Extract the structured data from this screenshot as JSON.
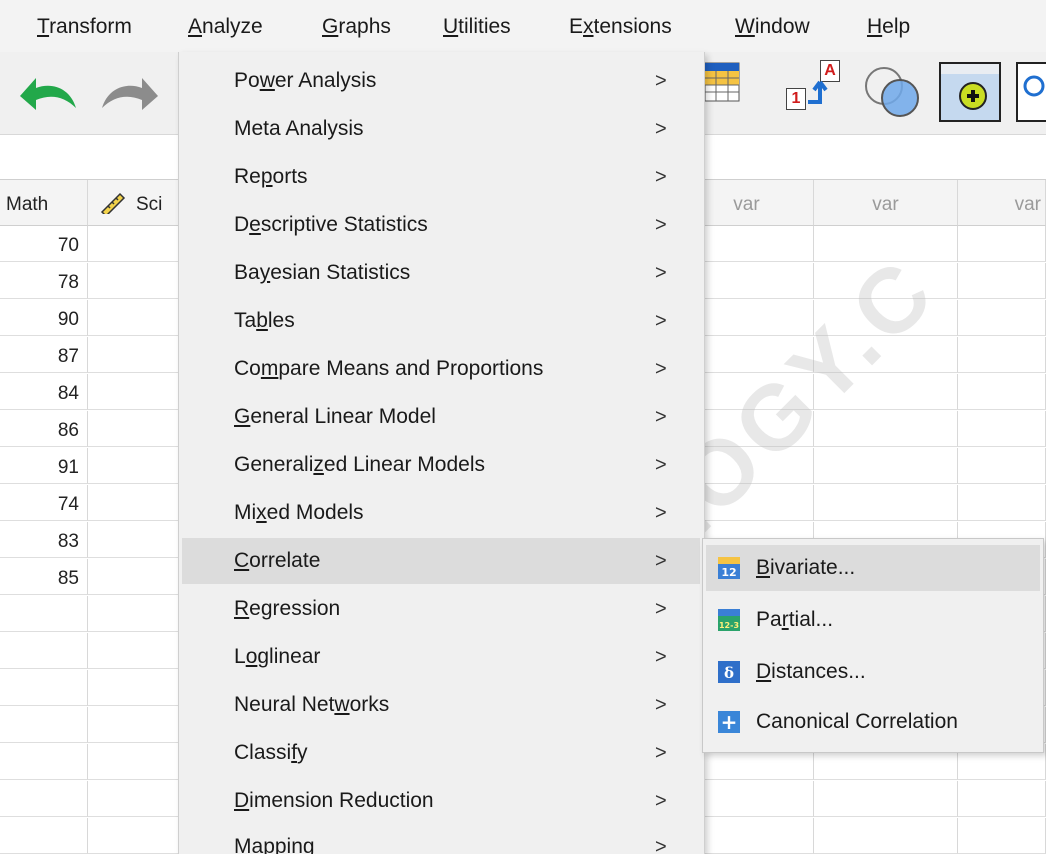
{
  "menubar": [
    {
      "pre": "",
      "u": "T",
      "post": "ransform"
    },
    {
      "pre": "",
      "u": "A",
      "post": "nalyze"
    },
    {
      "pre": "",
      "u": "G",
      "post": "raphs"
    },
    {
      "pre": "",
      "u": "U",
      "post": "tilities"
    },
    {
      "pre": "E",
      "u": "x",
      "post": "tensions"
    },
    {
      "pre": "",
      "u": "W",
      "post": "indow"
    },
    {
      "pre": "",
      "u": "H",
      "post": "elp"
    }
  ],
  "grid": {
    "headers": [
      "Math",
      "Sci",
      "var",
      "var",
      "var"
    ],
    "math_values": [
      "70",
      "78",
      "90",
      "87",
      "84",
      "86",
      "91",
      "74",
      "83",
      "85"
    ]
  },
  "analyze_menu": [
    {
      "pre": "Po",
      "u": "w",
      "post": "er Analysis"
    },
    {
      "pre": "Meta Analysis",
      "u": "",
      "post": ""
    },
    {
      "pre": "Re",
      "u": "p",
      "post": "orts"
    },
    {
      "pre": "D",
      "u": "e",
      "post": "scriptive Statistics"
    },
    {
      "pre": "Ba",
      "u": "y",
      "post": "esian Statistics"
    },
    {
      "pre": "Ta",
      "u": "b",
      "post": "les"
    },
    {
      "pre": "Co",
      "u": "m",
      "post": "pare Means and Proportions"
    },
    {
      "pre": "",
      "u": "G",
      "post": "eneral Linear Model"
    },
    {
      "pre": "Generali",
      "u": "z",
      "post": "ed Linear Models"
    },
    {
      "pre": "Mi",
      "u": "x",
      "post": "ed Models"
    },
    {
      "pre": "",
      "u": "C",
      "post": "orrelate"
    },
    {
      "pre": "",
      "u": "R",
      "post": "egression"
    },
    {
      "pre": "L",
      "u": "o",
      "post": "glinear"
    },
    {
      "pre": "Neural Net",
      "u": "w",
      "post": "orks"
    },
    {
      "pre": "Classi",
      "u": "f",
      "post": "y"
    },
    {
      "pre": "",
      "u": "D",
      "post": "imension Reduction"
    },
    {
      "pre": "M",
      "u": "a",
      "post": "pping"
    }
  ],
  "chevron": ">",
  "correlate_submenu": [
    {
      "pre": "",
      "u": "B",
      "post": "ivariate...",
      "icon": "bivariate-icon",
      "icon_text": "12"
    },
    {
      "pre": "Pa",
      "u": "r",
      "post": "tial...",
      "icon": "partial-icon",
      "icon_text": "12-3"
    },
    {
      "pre": "",
      "u": "D",
      "post": "istances...",
      "icon": "distances-icon",
      "icon_text": "δ"
    },
    {
      "pre": "Canonical Correlation",
      "u": "",
      "post": "",
      "icon": "canonical-correlation-icon",
      "icon_text": "+"
    }
  ],
  "toolbar": {
    "variable_icon_labels": [
      "A",
      "1"
    ]
  },
  "watermark": "OLOGY.C",
  "colors": {
    "menu_bg": "#f0f0f0",
    "highlight": "#dcdcdc",
    "toolbar_green": "#22a84a"
  }
}
